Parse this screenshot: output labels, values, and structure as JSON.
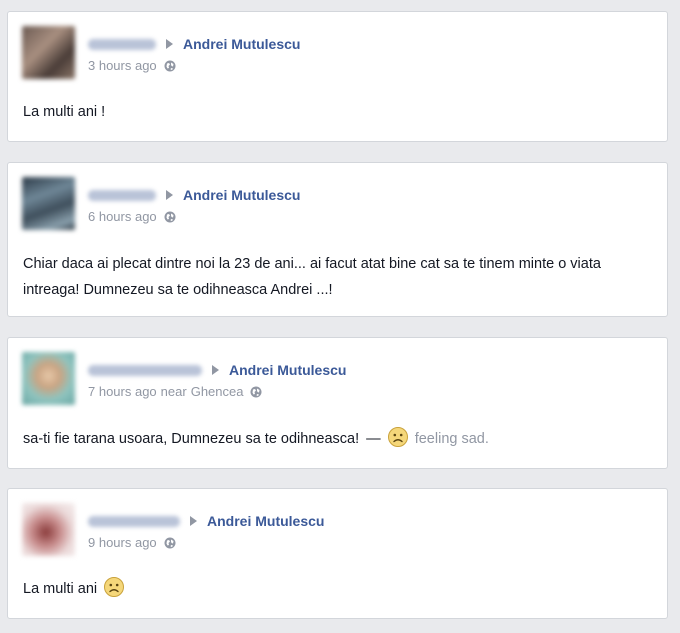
{
  "posts": [
    {
      "author": "",
      "target": "Andrei Mutulescu",
      "time": "3 hours ago",
      "location_prefix": "",
      "location": "",
      "text": "La multi ani !",
      "feeling": "",
      "privacy_icon": "globe-icon"
    },
    {
      "author": "",
      "target": "Andrei Mutulescu",
      "time": "6 hours ago",
      "location_prefix": "",
      "location": "",
      "text": "Chiar daca ai plecat dintre noi la 23 de ani... ai facut atat bine cat sa te tinem minte o viata intreaga! Dumnezeu sa te odihneasca Andrei ...!",
      "feeling": "",
      "privacy_icon": "globe-icon"
    },
    {
      "author": "",
      "target": "Andrei Mutulescu",
      "time": "7 hours ago",
      "location_prefix": "near",
      "location": "Ghencea",
      "text": "sa-ti fie tarana usoara, Dumnezeu sa te odihneasca!",
      "feeling_separator": "—",
      "feeling": "feeling sad.",
      "feeling_icon": "sad-face-icon",
      "privacy_icon": "globe-icon"
    },
    {
      "author": "",
      "target": "Andrei Mutulescu",
      "time": "9 hours ago",
      "location_prefix": "",
      "location": "",
      "text": "La multi ani",
      "trailing_icon": "sad-face-icon",
      "feeling": "",
      "privacy_icon": "globe-icon"
    }
  ],
  "colors": {
    "background": "#e9eaed",
    "link": "#3b5998",
    "meta": "#9197a3",
    "text": "#141823"
  }
}
